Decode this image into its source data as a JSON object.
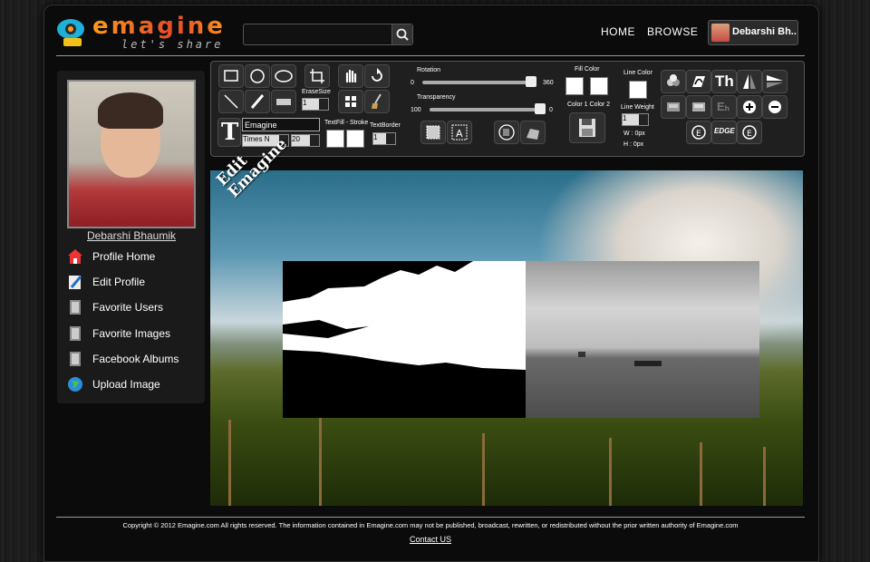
{
  "brand": {
    "name": "emagine",
    "tagline": "let's share"
  },
  "search": {
    "value": "",
    "placeholder": ""
  },
  "nav": {
    "home": "HOME",
    "browse": "BROWSE",
    "user": "Debarshi Bh.."
  },
  "sidebar": {
    "user_name": "Debarshi Bhaumik",
    "items": [
      {
        "label": "Profile Home",
        "icon": "house-icon"
      },
      {
        "label": "Edit Profile",
        "icon": "pencil-icon"
      },
      {
        "label": "Favorite Users",
        "icon": "book-icon"
      },
      {
        "label": "Favorite Images",
        "icon": "book-icon"
      },
      {
        "label": "Facebook Albums",
        "icon": "book-icon"
      },
      {
        "label": "Upload Image",
        "icon": "globe-icon"
      }
    ]
  },
  "toolbar": {
    "erase_size_label": "EraseSize",
    "erase_size_value": "1",
    "text_value": "Emagine",
    "font_value": "Times N",
    "font_size_value": "20",
    "textfill_label": "TextFill - Stroke",
    "textborder_label": "TextBorder",
    "textborder_value": "1",
    "rotation_label": "Rotation",
    "rotation_min": "0",
    "rotation_max": "360",
    "rotation_value": 0.95,
    "transparency_label": "Transparency",
    "transparency_min": "100",
    "transparency_max": "0",
    "transparency_value": 1.0,
    "fill_color_label": "Fill Color",
    "color_labels": "Color 1 Color 2",
    "line_color_label": "Line Color",
    "line_weight_label": "Line Weight",
    "line_weight_value": "1",
    "width_readout": "W : 0px",
    "height_readout": "H : 0px",
    "edge_label": "EDGE",
    "text_tool_glyph": "T",
    "th_glyph": "Th",
    "em_glyph": "Eₕ"
  },
  "canvas": {
    "overlay_text_line1": "Edit",
    "overlay_text_line2": "Emagine"
  },
  "footer": {
    "copyright": "Copyright © 2012 Emagine.com All rights reserved. The information contained in Emagine.com may not be published, broadcast, rewritten, or redistributed without the prior written authority of Emagine.com",
    "contact": "Contact US"
  },
  "colors": {
    "accent": "#ff8a1a",
    "background": "#0b0b0b",
    "panel": "#1f1f1f"
  }
}
